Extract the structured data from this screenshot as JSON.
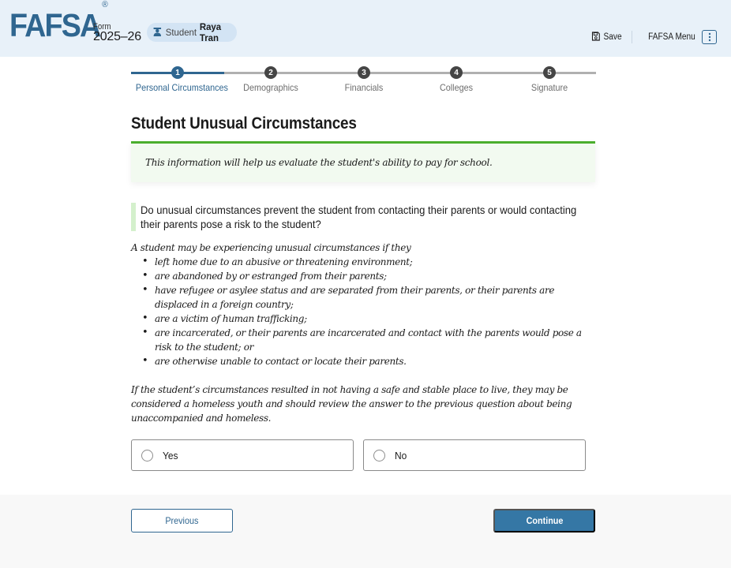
{
  "header": {
    "logo": "FAFSA",
    "logo_mark": "®",
    "form_label": "Form",
    "form_year": "2025–26",
    "student_label": "Student",
    "student_name": "Raya Tran",
    "student_icon": "graduate-icon",
    "save_label": "Save",
    "save_icon": "floppy-disk-icon",
    "menu_label": "FAFSA Menu",
    "menu_icon": "kebab-vertical-icon"
  },
  "stepper": {
    "current_step": 1,
    "steps": [
      {
        "number": "1",
        "label": "Personal Circumstances",
        "active": true
      },
      {
        "number": "2",
        "label": "Demographics",
        "active": false
      },
      {
        "number": "3",
        "label": "Financials",
        "active": false
      },
      {
        "number": "4",
        "label": "Colleges",
        "active": false
      },
      {
        "number": "5",
        "label": "Signature",
        "active": false
      }
    ]
  },
  "page": {
    "title": "Student Unusual Circumstances",
    "info": "This information will help us evaluate the student's ability to pay for school.",
    "question": "Do unusual circumstances prevent the student from contacting their parents or would contacting their parents pose a risk to the student?",
    "help_intro": "A student may be experiencing unusual circumstances if they",
    "help_items": [
      "left home due to an abusive or threatening environment;",
      "are abandoned by or estranged from their parents;",
      "have refugee or asylee status and are separated from their parents, or their parents are displaced in a foreign country;",
      "are a victim of human trafficking;",
      "are incarcerated, or their parents are incarcerated and contact with the parents would pose a risk to the student; or",
      "are otherwise unable to contact or locate their parents."
    ],
    "help_note": "If the student’s circumstances resulted in not having a safe and stable place to live, they may be considered a homeless youth and should review the answer to the previous question about being unaccompanied and homeless.",
    "options": [
      {
        "label": "Yes",
        "selected": false
      },
      {
        "label": "No",
        "selected": false
      }
    ]
  },
  "footer": {
    "previous_label": "Previous",
    "continue_label": "Continue"
  },
  "colors": {
    "brand": "#2f6690",
    "header_bg": "#e8f1f9",
    "success_border": "#4aae2d",
    "info_bg": "#f2faf0",
    "primary_button": "#3577a5"
  }
}
